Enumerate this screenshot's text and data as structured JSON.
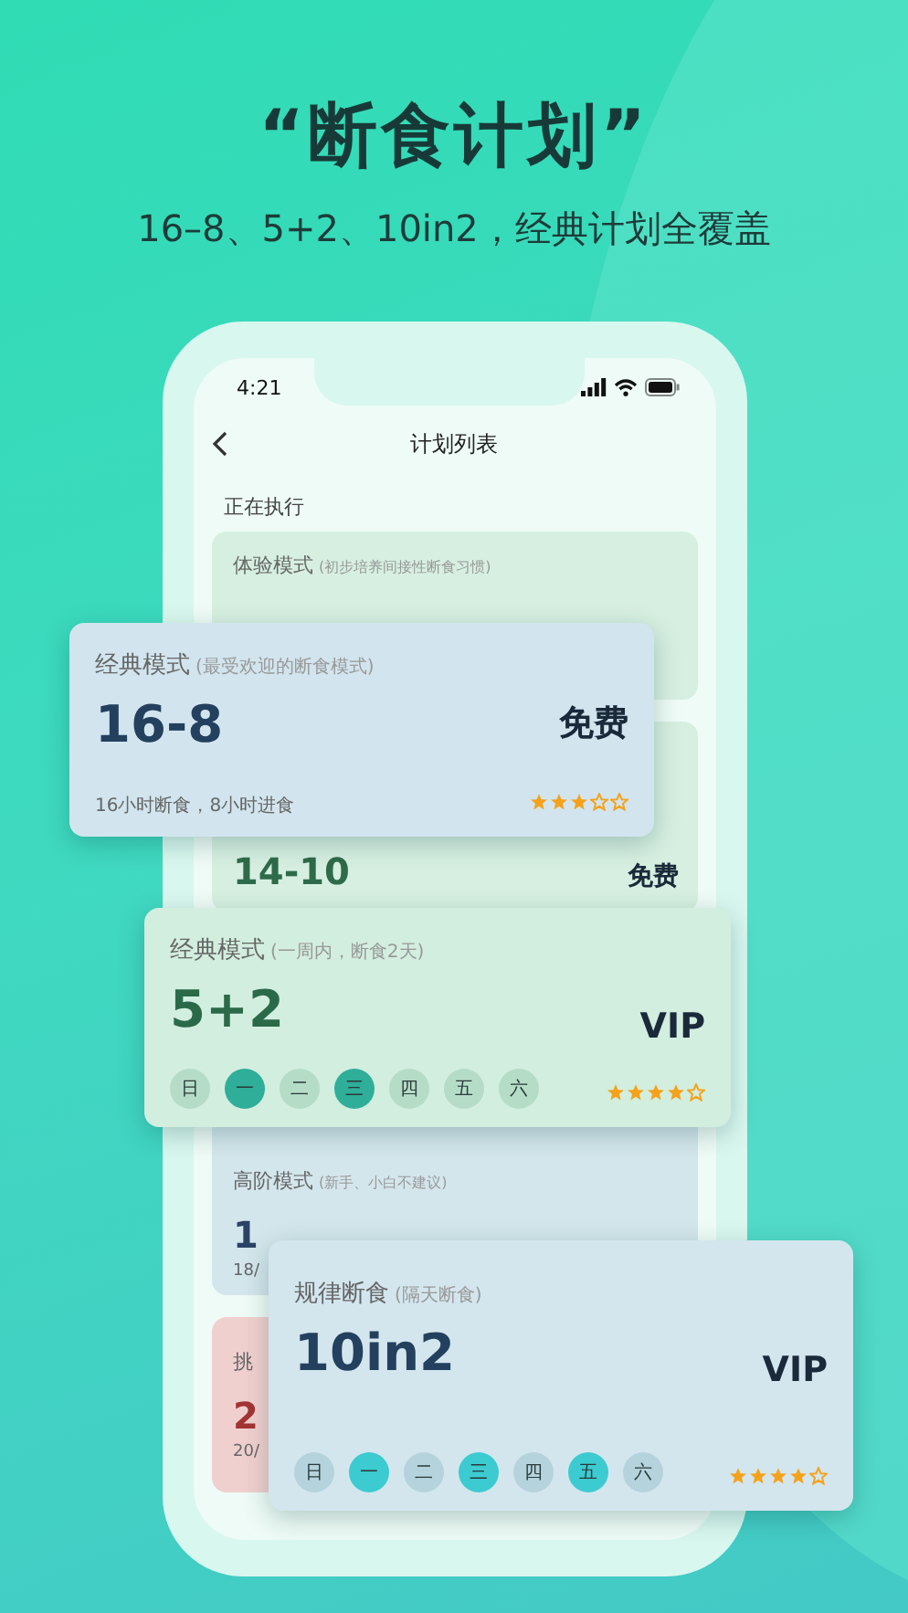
{
  "headline": "“断食计划”",
  "subtitle": "16–8、5+2、10in2，经典计划全覆盖",
  "status_bar": {
    "time": "4:21"
  },
  "nav": {
    "title": "计划列表"
  },
  "section_label": "正在执行",
  "list_cards": [
    {
      "color": "#d6efe1",
      "title": "体验模式",
      "note": "(初步培养间接性断食习惯)"
    },
    {
      "color": "#d6efe1",
      "big": "14-10",
      "badge": "免费"
    },
    {
      "color": "#d3e6ec",
      "title": "高阶模式",
      "note": "(新手、小白不建议)",
      "big": "1",
      "desc": "18/"
    },
    {
      "color": "#f0d0cf",
      "title": "挑",
      "big": "2",
      "desc": "20/"
    }
  ],
  "float_cards": [
    {
      "color": "#d2e5ee",
      "title": "经典模式",
      "note": "(最受欢迎的断食模式)",
      "big": "16-8",
      "badge": "免费",
      "desc": "16小时断食，8小时进食",
      "stars": 3
    },
    {
      "color": "#d2eedf",
      "title": "经典模式",
      "note": "(一周内，断食2天)",
      "big": "5+2",
      "badge": "VIP",
      "stars": 4,
      "days": [
        {
          "label": "日",
          "selected": false
        },
        {
          "label": "一",
          "selected": true
        },
        {
          "label": "二",
          "selected": false
        },
        {
          "label": "三",
          "selected": true
        },
        {
          "label": "四",
          "selected": false
        },
        {
          "label": "五",
          "selected": false
        },
        {
          "label": "六",
          "selected": false
        }
      ]
    },
    {
      "color": "#d3e6ee",
      "title": "规律断食",
      "note": "(隔天断食)",
      "big": "10in2",
      "badge": "VIP",
      "stars": 4,
      "days": [
        {
          "label": "日",
          "selected": false
        },
        {
          "label": "一",
          "selected": true
        },
        {
          "label": "二",
          "selected": false
        },
        {
          "label": "三",
          "selected": true
        },
        {
          "label": "四",
          "selected": false
        },
        {
          "label": "五",
          "selected": true
        },
        {
          "label": "六",
          "selected": false
        }
      ]
    }
  ]
}
